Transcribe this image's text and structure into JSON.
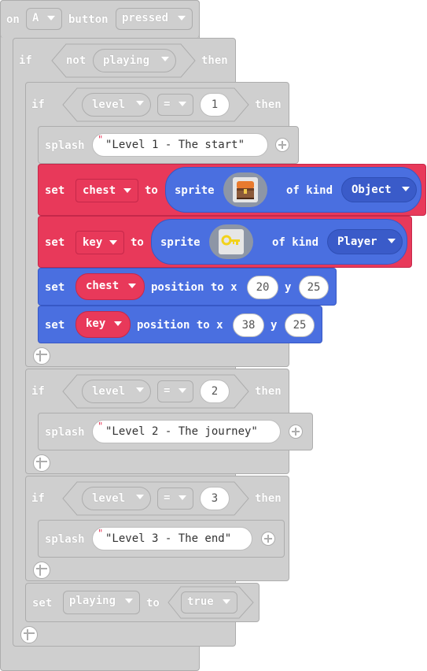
{
  "event": {
    "on": "on",
    "button": "A",
    "button_word": "button",
    "action": "pressed"
  },
  "if1": {
    "if": "if",
    "not": "not",
    "var": "playing",
    "then": "then"
  },
  "if_level1": {
    "if": "if",
    "var": "level",
    "op": "=",
    "value": "1",
    "then": "then"
  },
  "splash1": {
    "label": "splash",
    "text": "\"Level 1 - The start\""
  },
  "set_chest": {
    "set": "set",
    "var": "chest",
    "to": "to",
    "sprite": "sprite",
    "of_kind": "of kind",
    "kind": "Object",
    "image": "treasure-chest"
  },
  "set_key": {
    "set": "set",
    "var": "key",
    "to": "to",
    "sprite": "sprite",
    "of_kind": "of kind",
    "kind": "Player",
    "image": "key"
  },
  "pos_chest": {
    "set": "set",
    "var": "chest",
    "position_to": "position to x",
    "y_label": "y",
    "x": "20",
    "y": "25"
  },
  "pos_key": {
    "set": "set",
    "var": "key",
    "position_to": "position to x",
    "y_label": "y",
    "x": "38",
    "y": "25"
  },
  "if_level2": {
    "if": "if",
    "var": "level",
    "op": "=",
    "value": "2",
    "then": "then"
  },
  "splash2": {
    "label": "splash",
    "text": "\"Level 2 - The journey\""
  },
  "if_level3": {
    "if": "if",
    "var": "level",
    "op": "=",
    "value": "3",
    "then": "then"
  },
  "splash3": {
    "label": "splash",
    "text": "\"Level 3 - The end\""
  },
  "set_playing": {
    "set": "set",
    "var": "playing",
    "to": "to",
    "value": "true"
  },
  "colors": {
    "gray_block": "#cfcfcf",
    "sprites_red": "#e8395a",
    "sprites_blue": "#4a6fe0"
  }
}
